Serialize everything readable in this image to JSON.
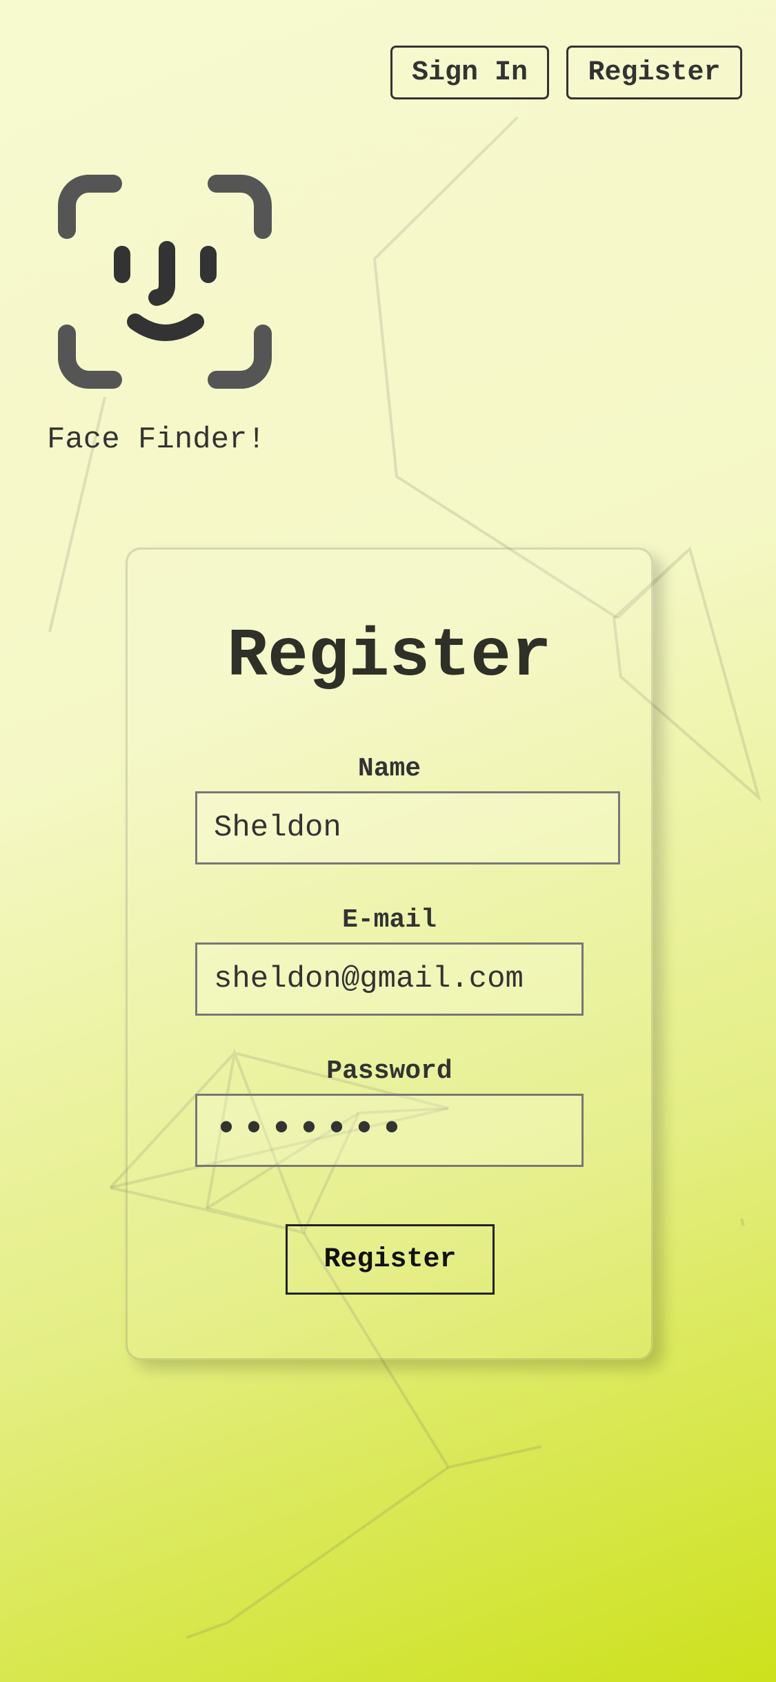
{
  "nav": {
    "sign_in_label": "Sign In",
    "register_label": "Register"
  },
  "brand": {
    "name": "Face Finder!"
  },
  "form": {
    "title": "Register",
    "name_label": "Name",
    "name_value": "Sheldon",
    "email_label": "E-mail",
    "email_value": "sheldon@gmail.com",
    "password_label": "Password",
    "password_value": "•••••••",
    "submit_label": "Register"
  },
  "colors": {
    "background_start": "#f7f9cf",
    "background_end": "#cde11c",
    "text": "#2f3027",
    "logo": "#555555"
  },
  "icons": {
    "logo": "face-id-icon"
  }
}
